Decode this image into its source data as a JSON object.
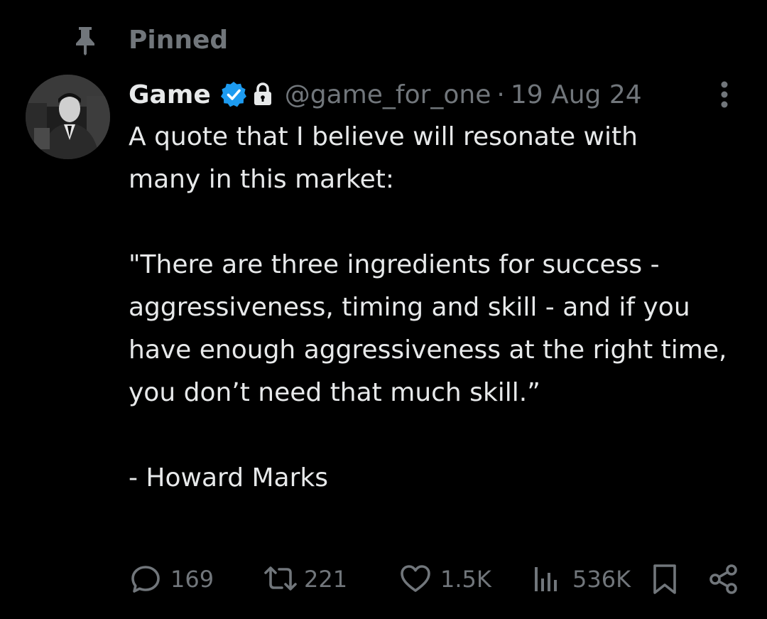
{
  "pinned": {
    "label": "Pinned",
    "icon": "pin-icon"
  },
  "author": {
    "name": "Game",
    "verified_icon": "verified-badge-icon",
    "protected_icon": "lock-icon",
    "handle": "@game_for_one",
    "separator": "·",
    "timestamp": "19 Aug 24",
    "avatar_icon": "avatar-photo"
  },
  "tweet": {
    "line1": "A quote that I believe will resonate with many in this market:",
    "quote": "\"There are three ingredients for success - aggressiveness, timing and skill - and if you have enough aggressiveness at the right time, you don’t need that much skill.”",
    "attribution": "- Howard Marks"
  },
  "actions": {
    "replies": "169",
    "reposts": "221",
    "likes": "1.5K",
    "views": "536K"
  },
  "colors": {
    "background": "#000000",
    "text": "#e7e9ea",
    "muted": "#71767b",
    "verified": "#1d9bf0"
  }
}
